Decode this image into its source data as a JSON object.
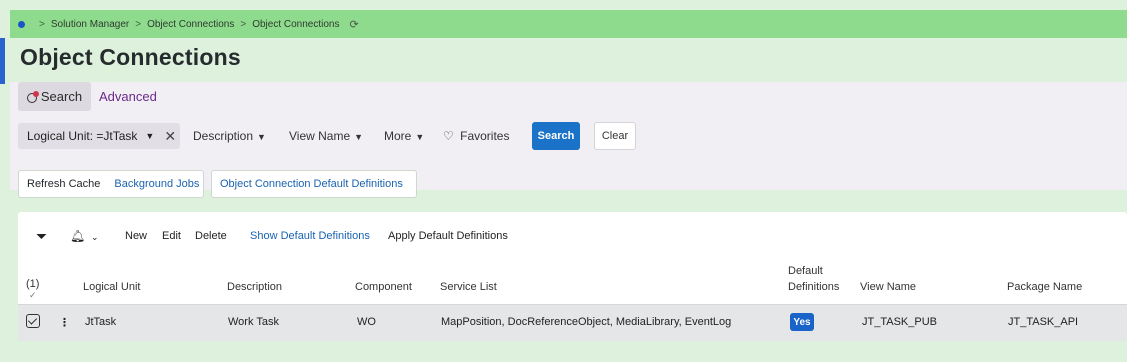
{
  "breadcrumb": {
    "items": [
      "Solution Manager",
      "Object Connections",
      "Object Connections"
    ]
  },
  "page": {
    "title": "Object Connections"
  },
  "search_tabs": {
    "search": "Search",
    "advanced": "Advanced"
  },
  "filters": {
    "logical_unit_chip": "Logical Unit: =JtTask",
    "description": "Description",
    "view_name": "View Name",
    "more": "More",
    "favorites": "Favorites",
    "search_button": "Search",
    "clear_button": "Clear"
  },
  "commands": {
    "refresh_cache": "Refresh Cache",
    "background_jobs": "Background Jobs",
    "default_definitions": "Object Connection Default Definitions"
  },
  "toolbar": {
    "new": "New",
    "edit": "Edit",
    "delete": "Delete",
    "show_default": "Show Default Definitions",
    "apply_default": "Apply Default Definitions"
  },
  "table": {
    "selected_count": "(1)",
    "columns": [
      "Logical Unit",
      "Description",
      "Component",
      "Service List",
      "Default",
      "Definitions",
      "View Name",
      "Package Name"
    ],
    "rows": [
      {
        "logical_unit": "JtTask",
        "description": "Work Task",
        "component": "WO",
        "service_list": "MapPosition, DocReferenceObject, MediaLibrary, EventLog",
        "default_definitions": "Yes",
        "view_name": "JT_TASK_PUB",
        "package_name": "JT_TASK_API"
      }
    ]
  },
  "colors": {
    "topbar": "#8edb8e",
    "background": "#ddf1dd",
    "accent": "#1a73c9",
    "link": "#1a63b0"
  }
}
